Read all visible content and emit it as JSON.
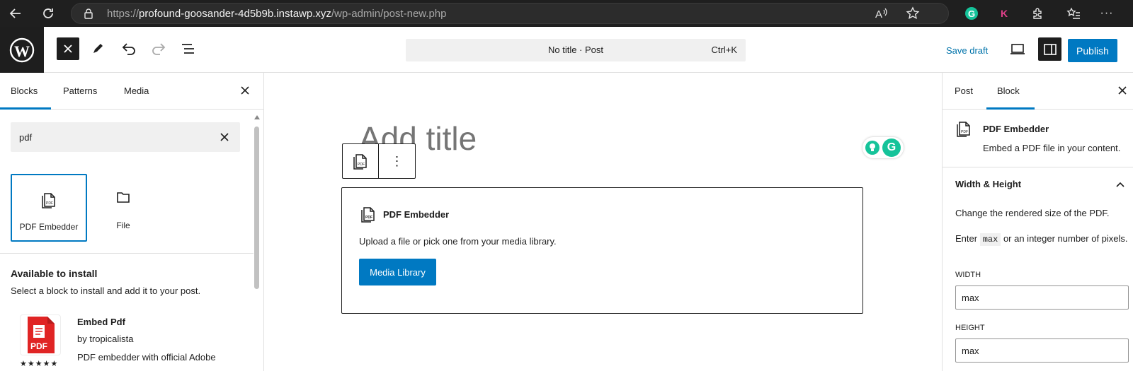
{
  "browser": {
    "url_prefix": "https://",
    "url_host": "profound-goosander-4d5b9b.instawp.xyz",
    "url_path": "/wp-admin/post-new.php"
  },
  "header": {
    "command_title": "No title · Post",
    "command_shortcut": "Ctrl+K",
    "save_draft": "Save draft",
    "publish": "Publish"
  },
  "inserter": {
    "tabs": [
      "Blocks",
      "Patterns",
      "Media"
    ],
    "search_value": "pdf",
    "blocks": [
      {
        "label": "PDF Embedder",
        "icon": "pdf-icon"
      },
      {
        "label": "File",
        "icon": "folder-icon"
      }
    ],
    "available_title": "Available to install",
    "available_desc": "Select a block to install and add it to your post.",
    "plugin": {
      "name": "Embed Pdf",
      "author": "by tropicalista",
      "desc": "PDF embedder with official Adobe",
      "icon_text": "PDF",
      "stars": "★★★★★"
    }
  },
  "canvas": {
    "title_placeholder": "Add title",
    "pdf_block": {
      "title": "PDF Embedder",
      "desc": "Upload a file or pick one from your media library.",
      "button": "Media Library"
    },
    "toolbar_more": "⋮"
  },
  "sidebar": {
    "tabs": [
      "Post",
      "Block"
    ],
    "block_title": "PDF Embedder",
    "block_desc": "Embed a PDF file in your content.",
    "section_title": "Width & Height",
    "section_desc": "Change the rendered size of the PDF.",
    "enter_pre": "Enter",
    "enter_code": "max",
    "enter_post": "or an integer number of pixels.",
    "width_label": "WIDTH",
    "width_value": "max",
    "height_label": "HEIGHT",
    "height_value": "max"
  },
  "colors": {
    "accent": "#0079c2",
    "dark": "#1e1e1e",
    "grammarly": "#15c39a",
    "pdf_red": "#e02424"
  }
}
